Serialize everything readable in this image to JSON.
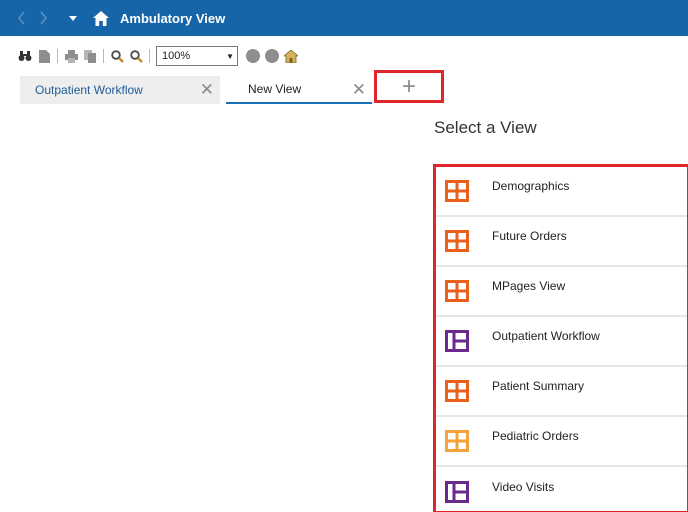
{
  "titlebar": {
    "title": "Ambulatory View",
    "back_icon": "chevron-left-icon",
    "forward_icon": "chevron-right-icon",
    "menu_icon": "caret-down-icon",
    "home_icon": "home-icon",
    "background": "#1665a8"
  },
  "toolbar": {
    "zoom_value": "100%"
  },
  "tabs": [
    {
      "label": "Outpatient Workflow",
      "active": false
    },
    {
      "label": "New View",
      "active": true
    }
  ],
  "add_tab": {
    "label": "+"
  },
  "main": {
    "heading": "Select a View",
    "views": [
      {
        "label": "Demographics",
        "icon": "layout-grid-icon",
        "color": "#e8601c"
      },
      {
        "label": "Future Orders",
        "icon": "layout-grid-icon",
        "color": "#e8601c"
      },
      {
        "label": "MPages View",
        "icon": "layout-grid-icon",
        "color": "#e8601c"
      },
      {
        "label": "Outpatient Workflow",
        "icon": "layout-columns-icon",
        "color": "#6a2a8c"
      },
      {
        "label": "Patient Summary",
        "icon": "layout-grid-icon",
        "color": "#e8601c"
      },
      {
        "label": "Pediatric Orders",
        "icon": "layout-grid-icon",
        "color": "#f5a23a"
      },
      {
        "label": "Video Visits",
        "icon": "layout-columns-icon",
        "color": "#6a2a8c"
      }
    ]
  },
  "highlight_color": "#e0262b"
}
